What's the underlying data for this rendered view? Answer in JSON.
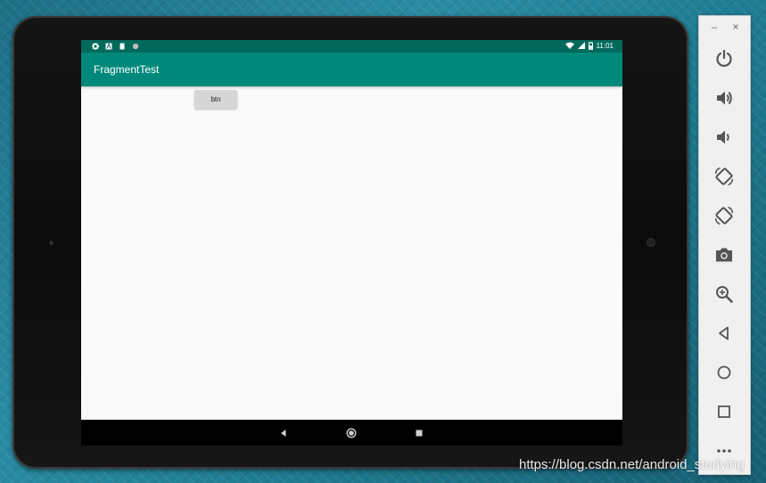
{
  "status_bar": {
    "time": "11:01",
    "left_icons": [
      "gear-icon",
      "a-icon",
      "sd-card-icon",
      "circle-icon"
    ],
    "right_icons": [
      "wifi-icon",
      "signal-icon",
      "battery-icon"
    ]
  },
  "app": {
    "title": "FragmentTest",
    "button_label": "btn"
  },
  "nav_bar": {
    "icons": [
      "back-triangle-icon",
      "home-circle-icon",
      "recents-square-icon"
    ]
  },
  "toolbar": {
    "minimize_label": "–",
    "close_label": "×",
    "items": [
      {
        "name": "power-icon"
      },
      {
        "name": "volume-up-icon"
      },
      {
        "name": "volume-down-icon"
      },
      {
        "name": "rotate-left-icon"
      },
      {
        "name": "rotate-right-icon"
      },
      {
        "name": "camera-icon"
      },
      {
        "name": "zoom-icon"
      },
      {
        "name": "back-icon"
      },
      {
        "name": "home-icon"
      },
      {
        "name": "overview-icon"
      },
      {
        "name": "more-icon"
      }
    ]
  },
  "colors": {
    "status_bar": "#00695c",
    "app_bar": "#00897b",
    "screen_bg": "#fafafa",
    "toolbar_icon": "#555555"
  },
  "watermark": "https://blog.csdn.net/android_studying"
}
